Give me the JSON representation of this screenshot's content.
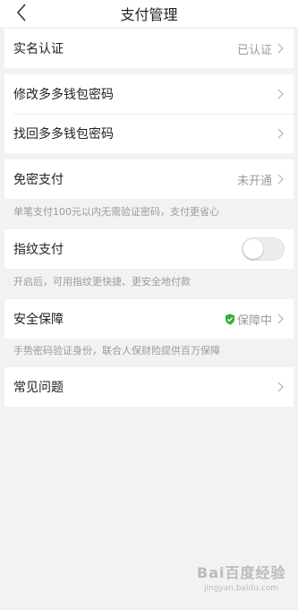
{
  "header": {
    "title": "支付管理",
    "back_icon": "chevron-left-icon"
  },
  "identity": {
    "label": "实名认证",
    "value": "已认证"
  },
  "password": {
    "change_label": "修改多多钱包密码",
    "recover_label": "找回多多钱包密码"
  },
  "password_free": {
    "label": "免密支付",
    "value": "未开通",
    "hint": "单笔支付100元以内无需验证密码，支付更省心"
  },
  "fingerprint": {
    "label": "指纹支付",
    "enabled": false,
    "hint": "开启后，可用指纹更快捷、更安全地付款"
  },
  "security": {
    "label": "安全保障",
    "value": "保障中",
    "icon": "green-shield-check-icon",
    "hint": "手势密码验证身份，联合人保财险提供百万保障"
  },
  "faq": {
    "label": "常见问题"
  },
  "watermark": {
    "text": "Bai百度经验",
    "url": "jingyan.baidu.com"
  },
  "colors": {
    "shield": "#2eb03c",
    "background": "#f2f2f2",
    "text_secondary": "#9a9a9a"
  }
}
